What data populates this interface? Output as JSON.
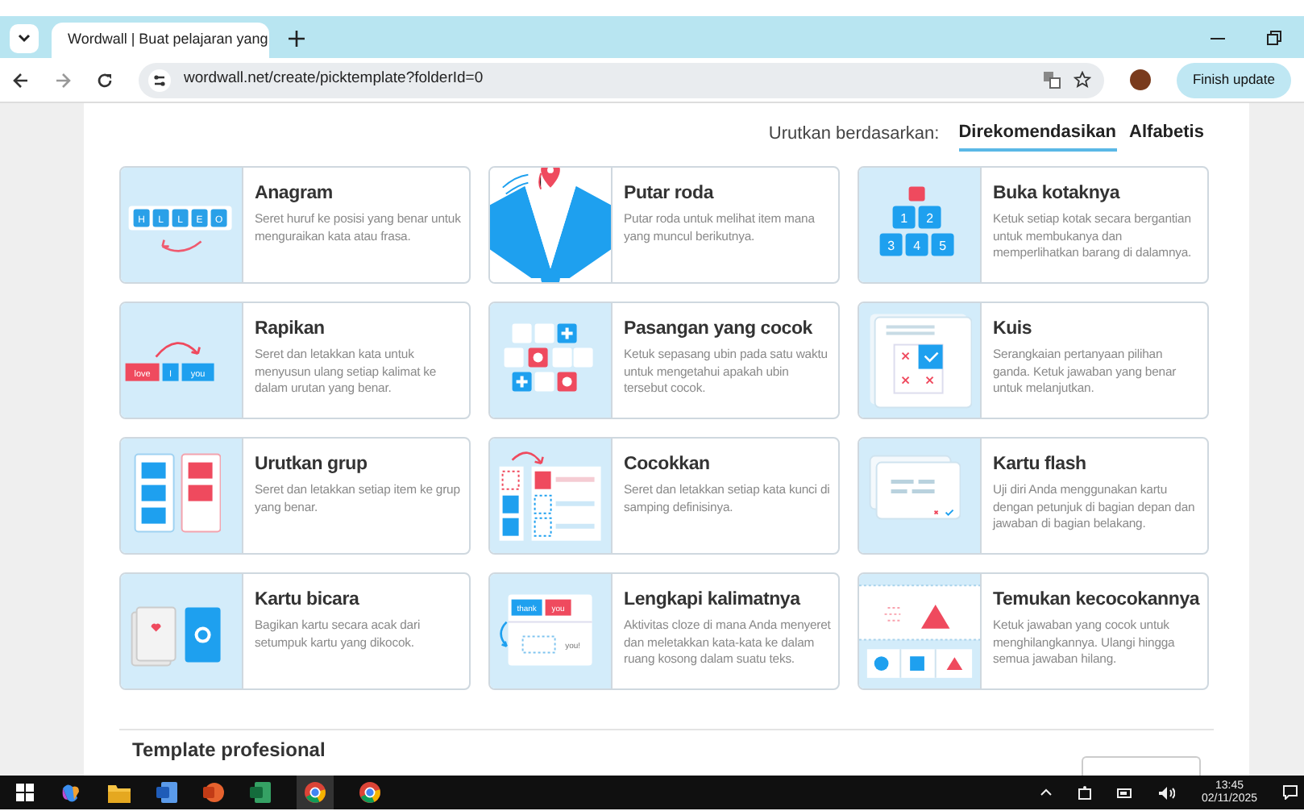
{
  "browser": {
    "tab_title": "Wordwall | Buat pelajaran yang",
    "address": "wordwall.net/create/picktemplate?folderId=0",
    "update_button": "Finish update"
  },
  "sort": {
    "label": "Urutkan berdasarkan:",
    "options": [
      {
        "label": "Direkomendasikan",
        "selected": true
      },
      {
        "label": "Alfabetis",
        "selected": false
      }
    ]
  },
  "templates": [
    {
      "kind": "anagram",
      "title": "Anagram",
      "description": "Seret huruf ke posisi yang benar untuk menguraikan kata atau frasa.",
      "tiles": [
        "H",
        "L",
        "L",
        "E",
        "O"
      ]
    },
    {
      "kind": "wheel",
      "title": "Putar roda",
      "description": "Putar roda untuk melihat item mana yang muncul berikutnya."
    },
    {
      "kind": "boxes",
      "title": "Buka kotaknya",
      "description": "Ketuk setiap kotak secara bergantian untuk membukanya dan memperlihatkan barang di dalamnya.",
      "tiles": [
        "1",
        "2",
        "3",
        "4",
        "5"
      ]
    },
    {
      "kind": "unjumble",
      "title": "Rapikan",
      "description": "Seret dan letakkan kata untuk menyusun ulang setiap kalimat ke dalam urutan yang benar.",
      "tiles": [
        "love",
        "I",
        "you"
      ]
    },
    {
      "kind": "pairs",
      "title": "Pasangan yang cocok",
      "description": "Ketuk sepasang ubin pada satu waktu untuk mengetahui apakah ubin tersebut cocok."
    },
    {
      "kind": "quiz",
      "title": "Kuis",
      "description": "Serangkaian pertanyaan pilihan ganda. Ketuk jawaban yang benar untuk melanjutkan."
    },
    {
      "kind": "groups",
      "title": "Urutkan grup",
      "description": "Seret dan letakkan setiap item ke grup yang benar."
    },
    {
      "kind": "match",
      "title": "Cocokkan",
      "description": "Seret dan letakkan setiap kata kunci di samping definisinya."
    },
    {
      "kind": "flash",
      "title": "Kartu flash",
      "description": "Uji diri Anda menggunakan kartu dengan petunjuk di bagian depan dan jawaban di bagian belakang."
    },
    {
      "kind": "cards",
      "title": "Kartu bicara",
      "description": "Bagikan kartu secara acak dari setumpuk kartu yang dikocok."
    },
    {
      "kind": "cloze",
      "title": "Lengkapi kalimatnya",
      "description": "Aktivitas cloze di mana Anda menyeret dan meletakkan kata-kata ke dalam ruang kosong dalam suatu teks.",
      "tiles": [
        "thank",
        "you",
        "you!"
      ]
    },
    {
      "kind": "find",
      "title": "Temukan kecocokannya",
      "description": "Ketuk jawaban yang cocok untuk menghilangkannya. Ulangi hingga semua jawaban hilang."
    }
  ],
  "section_heading": "Template profesional",
  "taskbar": {
    "time": "13:45",
    "date": "02/11/2025"
  }
}
